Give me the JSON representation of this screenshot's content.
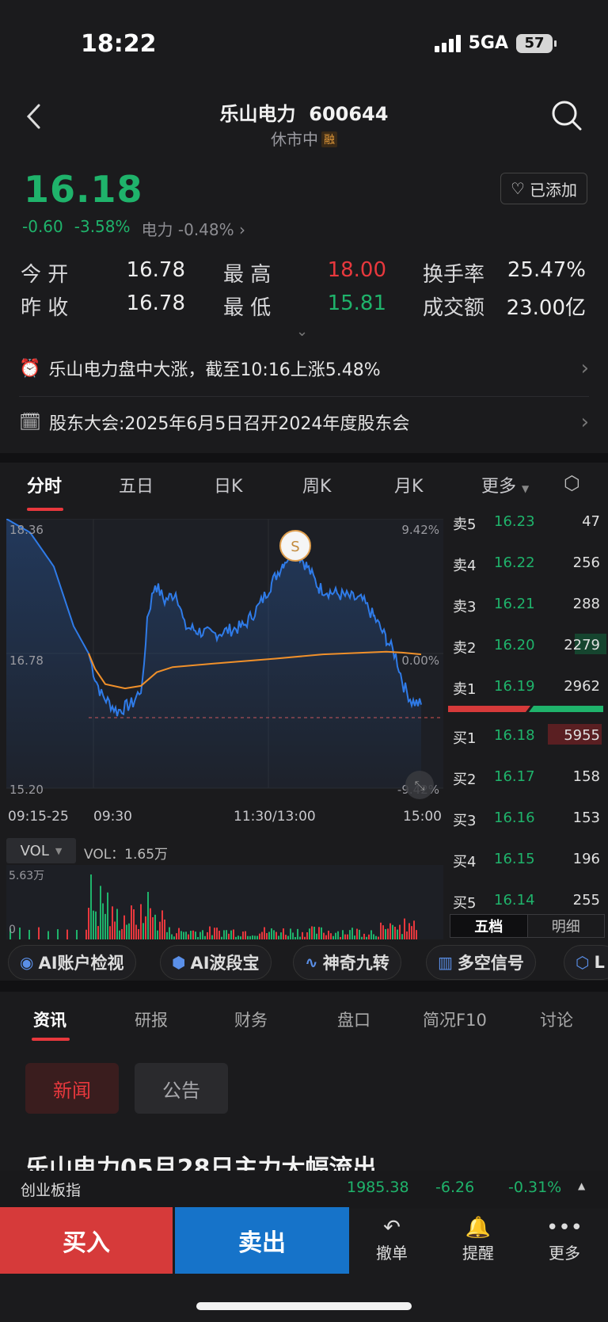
{
  "status": {
    "time": "18:22",
    "network": "5GA",
    "battery": "57"
  },
  "header": {
    "title": "乐山电力  600644",
    "subtitle": "休市中",
    "badge": "融"
  },
  "price": {
    "last": "16.18",
    "change": "-0.60",
    "change_pct": "-3.58%",
    "sector": "电力 -0.48%",
    "fav_label": "已添加"
  },
  "quote": {
    "open_label": "今 开",
    "open": "16.78",
    "high_label": "最 高",
    "high": "18.00",
    "turnover_label": "换手率",
    "turnover": "25.47%",
    "prev_label": "昨 收",
    "prev": "16.78",
    "low_label": "最 低",
    "low": "15.81",
    "amount_label": "成交额",
    "amount": "23.00亿"
  },
  "news": [
    {
      "text": "乐山电力盘中大涨，截至10:16上涨5.48%"
    },
    {
      "text": "股东大会:2025年6月5日召开2024年度股东会"
    }
  ],
  "chart_tabs": [
    "分时",
    "五日",
    "日K",
    "周K",
    "月K",
    "更多"
  ],
  "chart": {
    "y_top": "18.36",
    "y_mid": "16.78",
    "y_bot": "15.20",
    "pct_top": "9.42%",
    "pct_mid": "0.00%",
    "pct_bot": "-9.42%",
    "x_labels": [
      "09:15-25",
      "09:30",
      "11:30/13:00",
      "15:00"
    ],
    "marker": "S",
    "vol_selector": "VOL",
    "vol_value": "VOL：1.65万",
    "vol_max": "5.63万",
    "vol_zero": "0"
  },
  "order_book": {
    "asks": [
      {
        "label": "卖5",
        "price": "16.23",
        "vol": "47"
      },
      {
        "label": "卖4",
        "price": "16.22",
        "vol": "256"
      },
      {
        "label": "卖3",
        "price": "16.21",
        "vol": "288"
      },
      {
        "label": "卖2",
        "price": "16.20",
        "vol": "2279"
      },
      {
        "label": "卖1",
        "price": "16.19",
        "vol": "2962"
      }
    ],
    "bids": [
      {
        "label": "买1",
        "price": "16.18",
        "vol": "5955"
      },
      {
        "label": "买2",
        "price": "16.17",
        "vol": "158"
      },
      {
        "label": "买3",
        "price": "16.16",
        "vol": "153"
      },
      {
        "label": "买4",
        "price": "16.15",
        "vol": "196"
      },
      {
        "label": "买5",
        "price": "16.14",
        "vol": "255"
      }
    ],
    "tab_five": "五档",
    "tab_detail": "明细"
  },
  "features": [
    "AI账户检视",
    "AI波段宝",
    "神奇九转",
    "多空信号",
    "L"
  ],
  "info_tabs": [
    "资讯",
    "研报",
    "财务",
    "盘口",
    "简况F10",
    "讨论"
  ],
  "chips": {
    "news": "新闻",
    "notice": "公告"
  },
  "headline_partial": "乐山电力05月28日主力大幅流出",
  "index_bar": {
    "name": "创业板指",
    "value": "1985.38",
    "change": "-6.26",
    "pct": "-0.31%"
  },
  "actions": {
    "buy": "买入",
    "sell": "卖出",
    "cancel": "撤单",
    "alert": "提醒",
    "more": "更多"
  },
  "colors": {
    "up": "#e8383d",
    "down": "#1fb36b",
    "line": "#2f7be8",
    "avg": "#f0902a"
  }
}
